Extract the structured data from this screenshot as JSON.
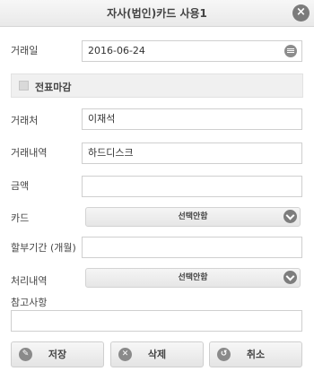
{
  "dialog": {
    "title": "자사(법인)카드 사용1",
    "close_icon": "close-icon"
  },
  "form": {
    "date_label": "거래일",
    "date_value": "2016-06-24",
    "checkbox_label": "전표마감",
    "checkbox_checked": false,
    "vendor_label": "거래처",
    "vendor_value": "이재석",
    "details_label": "거래내역",
    "details_value": "하드디스크",
    "amount_label": "금액",
    "amount_value": "",
    "card_label": "카드",
    "card_selected": "선택안함",
    "installment_label": "할부기간 (개월)",
    "installment_value": "",
    "process_label": "처리내역",
    "process_selected": "선택안함",
    "notes_label": "참고사항",
    "notes_value": ""
  },
  "buttons": {
    "save": "저장",
    "delete": "삭제",
    "cancel": "취소"
  },
  "icons": {
    "calendar": "calendar-icon",
    "dropdown": "chevron-down-icon",
    "pencil": "pencil-icon",
    "delete": "x-circle-icon",
    "cancel": "undo-icon"
  }
}
